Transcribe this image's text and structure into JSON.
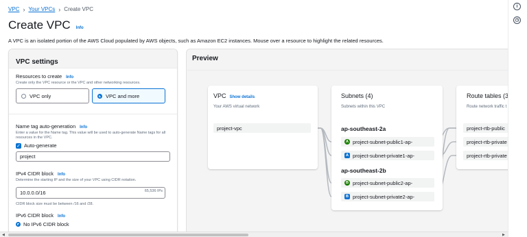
{
  "breadcrumb": {
    "items": [
      "VPC",
      "Your VPCs"
    ],
    "current": "Create VPC",
    "separator": "›"
  },
  "page": {
    "title": "Create VPC",
    "info": "Info",
    "description": "A VPC is an isolated portion of the AWS Cloud populated by AWS objects, such as Amazon EC2 instances. Mouse over a resource to highlight the related resources."
  },
  "settings": {
    "title": "VPC settings",
    "resources": {
      "label": "Resources to create",
      "info": "Info",
      "desc": "Create only the VPC resource or the VPC and other networking resources.",
      "options": [
        "VPC only",
        "VPC and more"
      ],
      "selected": "VPC and more"
    },
    "name_tag": {
      "label": "Name tag auto-generation",
      "info": "Info",
      "desc": "Enter a value for the Name tag. This value will be used to auto-generate Name tags for all resources in the VPC.",
      "checkbox_label": "Auto-generate",
      "value": "project"
    },
    "ipv4": {
      "label": "IPv4 CIDR block",
      "info": "Info",
      "desc": "Determine the starting IP and the size of your VPC using CIDR notation.",
      "value": "10.0.0.0/16",
      "suffix": "65,536 IPs",
      "hint": "CIDR block size must be between /16 and /28."
    },
    "ipv6": {
      "label": "IPv6 CIDR block",
      "info": "Info",
      "option": "No IPv6 CIDR block"
    }
  },
  "preview": {
    "title": "Preview",
    "vpc": {
      "title": "VPC",
      "link": "Show details",
      "subtitle": "Your AWS virtual network",
      "item": "project-vpc"
    },
    "subnets": {
      "title": "Subnets (4)",
      "subtitle": "Subnets within this VPC",
      "zones": [
        {
          "name": "ap-southeast-2a",
          "items": [
            {
              "badge": "A",
              "name": "project-subnet-public1-ap-"
            },
            {
              "badge": "A",
              "name": "project-subnet-private1-ap-"
            }
          ]
        },
        {
          "name": "ap-southeast-2b",
          "items": [
            {
              "badge": "B",
              "name": "project-subnet-public2-ap-"
            },
            {
              "badge": "B",
              "name": "project-subnet-private2-ap-"
            }
          ]
        }
      ]
    },
    "route_tables": {
      "title": "Route tables (3",
      "subtitle": "Route network traffic t",
      "items": [
        "project-rtb-public",
        "project-rtb-private",
        "project-rtb-private"
      ]
    }
  },
  "colors": {
    "link": "#0972d3",
    "public_badge": "#1d8102",
    "private_badge": "#0972d3"
  },
  "icons": {
    "rail_top": "info-icon",
    "rail_second": "history-icon"
  }
}
